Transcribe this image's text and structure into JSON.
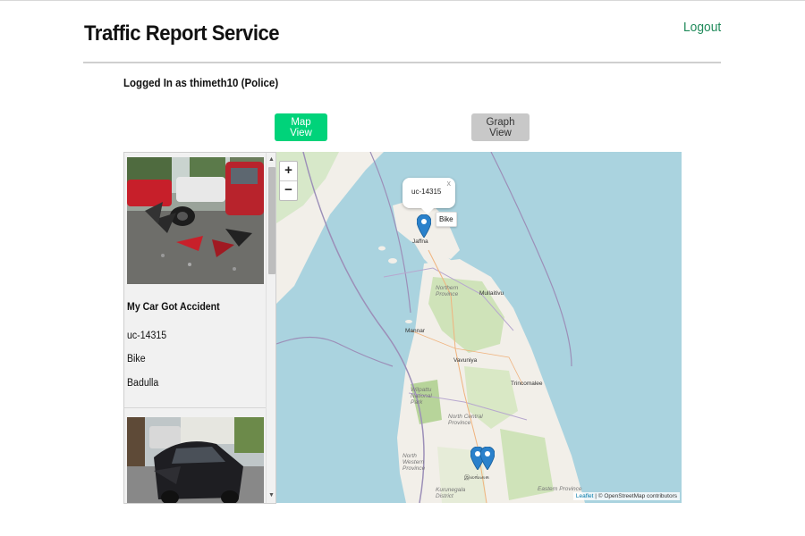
{
  "header": {
    "title": "Traffic Report Service",
    "logout_label": "Logout"
  },
  "session": {
    "logged_in_text": "Logged In as thimeth10 (Police)"
  },
  "view_buttons": {
    "map_view": "Map View",
    "graph_view": "Graph View"
  },
  "reports": [
    {
      "title": "My Car Got Accident",
      "id": "uc-14315",
      "vehicle": "Bike",
      "location": "Badulla"
    },
    {
      "title": "",
      "id": "",
      "vehicle": "",
      "location": ""
    }
  ],
  "map": {
    "popup_text": "uc-14315",
    "popup_close": "x",
    "tooltip_text": "Bike",
    "zoom_in": "+",
    "zoom_out": "−",
    "attribution_link": "Leaflet",
    "attribution_text": " | © OpenStreetMap contributors",
    "labels": {
      "jaffna": "Jaffna",
      "northern_province": "Northern Province",
      "mullaitivu": "Mullaitivu",
      "mannar": "Mannar",
      "vavuniya": "Vavuniya",
      "trincomalee": "Trincomalee",
      "wilpattu": "Wilpattu National Park",
      "north_central": "North Central Province",
      "north_western": "North Western Province",
      "kurunegala": "Kurunegala District",
      "eastern_province": "Eastern Province",
      "thambuttegama": "Thambuttegama",
      "dambulla": "இலங்கை"
    }
  },
  "colors": {
    "accent": "#00d37a",
    "logout": "#1f8a5a",
    "marker": "#2a81cb",
    "sea": "#aad3df",
    "land": "#f2efe9"
  }
}
